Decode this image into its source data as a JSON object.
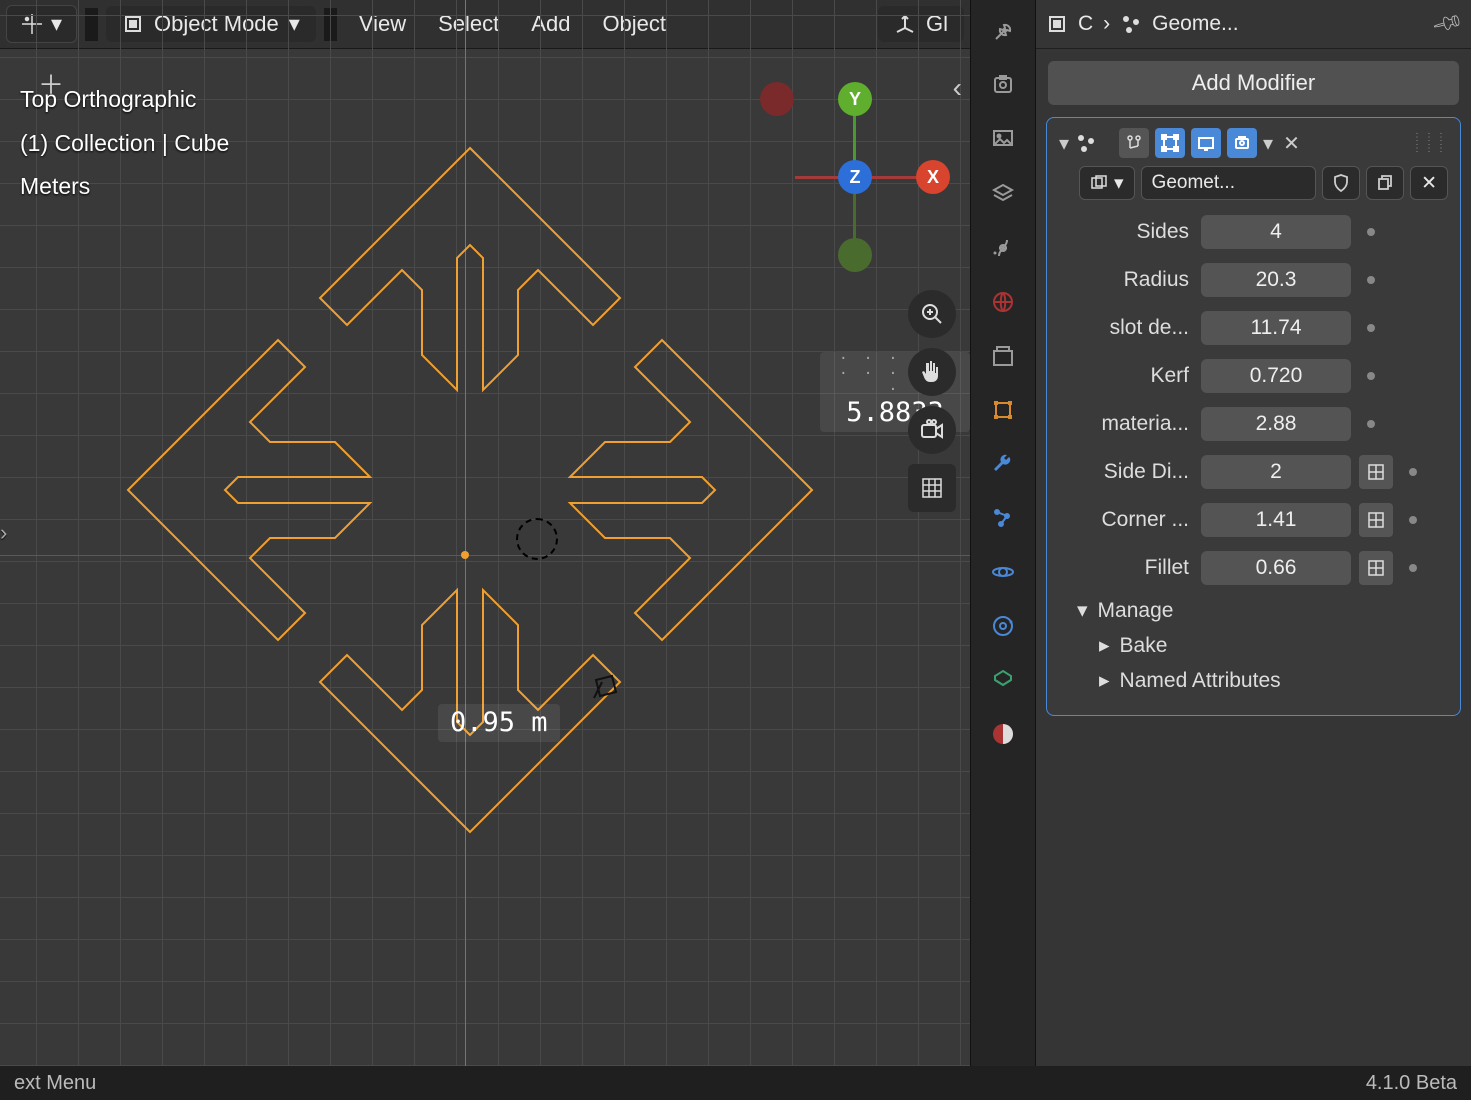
{
  "viewport": {
    "mode_label": "Object Mode",
    "menus": [
      "View",
      "Select",
      "Add",
      "Object"
    ],
    "gizmo_label": "Gl",
    "info_view": "Top Orthographic",
    "info_path": "(1) Collection | Cube",
    "info_units": "Meters",
    "zoom_number": "5.8833",
    "measure_label": "0.95 m"
  },
  "axis_gizmo": {
    "x": "X",
    "y": "Y",
    "z": "Z"
  },
  "breadcrumb": {
    "object_short": "C",
    "modifier_short": "Geome..."
  },
  "add_modifier_label": "Add Modifier",
  "modifier": {
    "name": "Geomet...",
    "props": [
      {
        "label": "Sides",
        "value": "4",
        "extra": false
      },
      {
        "label": "Radius",
        "value": "20.3",
        "extra": false
      },
      {
        "label": "slot de...",
        "value": "11.74",
        "extra": false
      },
      {
        "label": "Kerf",
        "value": "0.720",
        "extra": false
      },
      {
        "label": "materia...",
        "value": "2.88",
        "extra": false
      },
      {
        "label": "Side Di...",
        "value": "2",
        "extra": true
      },
      {
        "label": "Corner ...",
        "value": "1.41",
        "extra": true
      },
      {
        "label": "Fillet",
        "value": "0.66",
        "extra": true
      }
    ],
    "subpanels": [
      "Manage",
      "Bake",
      "Named Attributes"
    ]
  },
  "status": {
    "left": "ext Menu",
    "right": "4.1.0 Beta"
  }
}
